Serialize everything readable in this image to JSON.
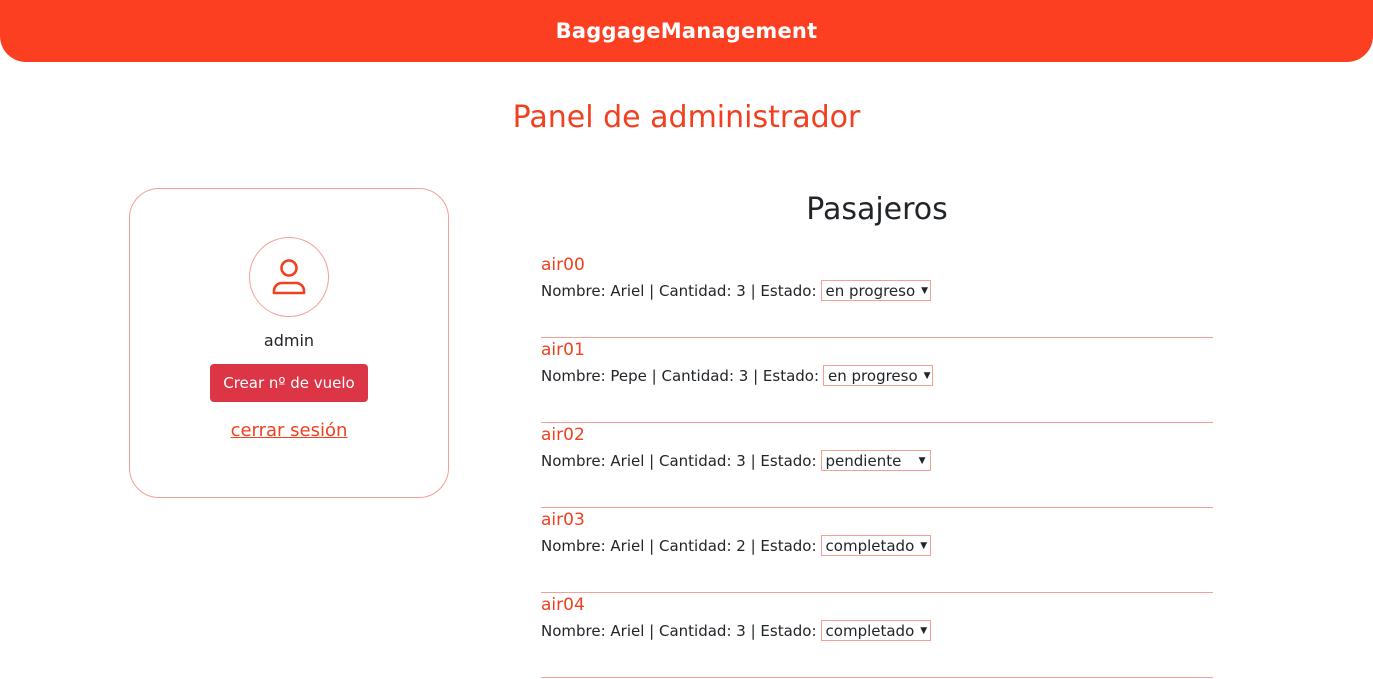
{
  "header": {
    "brand": "BaggageManagement"
  },
  "page": {
    "title": "Panel de administrador"
  },
  "profile": {
    "icon": "user-icon",
    "username": "admin",
    "create_flight_label": "Crear nº de vuelo",
    "logout_label": "cerrar sesión"
  },
  "passengers": {
    "title": "Pasajeros",
    "items": [
      {
        "code": "air00",
        "details": "Nombre: Ariel | Cantidad: 3 | Estado:",
        "status": "en progreso"
      },
      {
        "code": "air01",
        "details": "Nombre: Pepe | Cantidad: 3 | Estado:",
        "status": "en progreso"
      },
      {
        "code": "air02",
        "details": "Nombre: Ariel | Cantidad: 3 | Estado:",
        "status": "pendiente"
      },
      {
        "code": "air03",
        "details": "Nombre: Ariel | Cantidad: 2 | Estado:",
        "status": "completado"
      },
      {
        "code": "air04",
        "details": "Nombre: Ariel | Cantidad: 3 | Estado:",
        "status": "completado"
      }
    ]
  },
  "colors": {
    "accent": "#fd3f21",
    "accent_text": "#f0401f",
    "button": "#dc3545",
    "border": "#f4a094"
  }
}
